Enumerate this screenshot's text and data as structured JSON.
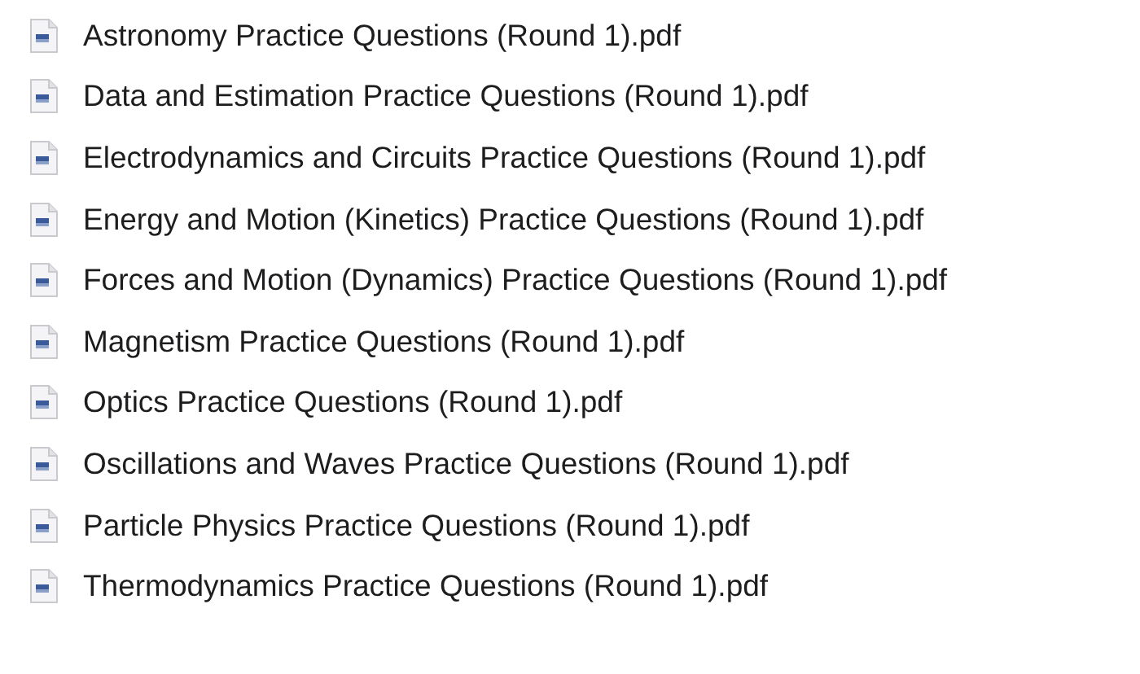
{
  "files": [
    {
      "name": "Astronomy Practice Questions (Round 1).pdf"
    },
    {
      "name": "Data and Estimation Practice Questions (Round 1).pdf"
    },
    {
      "name": "Electrodynamics and Circuits Practice Questions (Round 1).pdf"
    },
    {
      "name": "Energy and Motion (Kinetics) Practice Questions (Round 1).pdf"
    },
    {
      "name": "Forces and Motion (Dynamics) Practice Questions (Round 1).pdf"
    },
    {
      "name": "Magnetism Practice Questions (Round 1).pdf"
    },
    {
      "name": "Optics Practice Questions (Round 1).pdf"
    },
    {
      "name": "Oscillations and Waves Practice Questions (Round 1).pdf"
    },
    {
      "name": "Particle Physics Practice Questions (Round 1).pdf"
    },
    {
      "name": "Thermodynamics Practice Questions (Round 1).pdf"
    }
  ]
}
